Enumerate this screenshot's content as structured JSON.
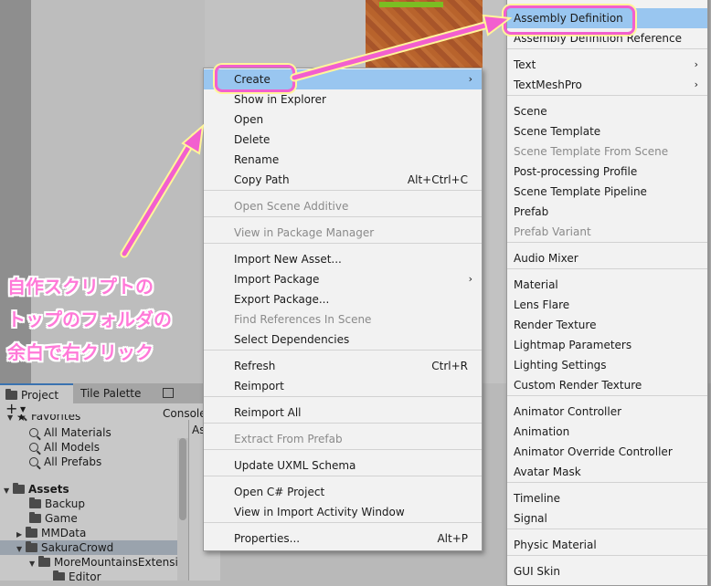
{
  "colors": {
    "accent_pink": "#f25fcf",
    "highlight_blue": "#99c6f0",
    "menu_bg": "#f2f2f2",
    "outline_yellow": "#fff59a"
  },
  "project_window": {
    "tabs": [
      "Project",
      "Tile Palette",
      "Console"
    ],
    "add_button": "+",
    "tree": {
      "favorites_label": "Favorites",
      "favorites": [
        "All Materials",
        "All Models",
        "All Prefabs"
      ],
      "assets_label": "Assets",
      "folders": [
        "Backup",
        "Game",
        "MMData",
        "SakuraCrowd",
        "MoreMountainsExtensi",
        "Editor"
      ]
    },
    "assets_pane_label": "Assets"
  },
  "context_menu": {
    "items": [
      {
        "label": "Create",
        "arrow": "›"
      },
      {
        "label": "Show in Explorer"
      },
      {
        "label": "Open"
      },
      {
        "label": "Delete"
      },
      {
        "label": "Rename"
      },
      {
        "label": "Copy Path",
        "shortcut": "Alt+Ctrl+C"
      },
      {
        "label": "Open Scene Additive"
      },
      {
        "label": "View in Package Manager"
      },
      {
        "label": "Import New Asset..."
      },
      {
        "label": "Import Package",
        "arrow": "›"
      },
      {
        "label": "Export Package..."
      },
      {
        "label": "Find References In Scene"
      },
      {
        "label": "Select Dependencies"
      },
      {
        "label": "Refresh",
        "shortcut": "Ctrl+R"
      },
      {
        "label": "Reimport"
      },
      {
        "label": "Reimport All"
      },
      {
        "label": "Extract From Prefab"
      },
      {
        "label": "Update UXML Schema"
      },
      {
        "label": "Open C# Project"
      },
      {
        "label": "View in Import Activity Window"
      },
      {
        "label": "Properties...",
        "shortcut": "Alt+P"
      }
    ]
  },
  "create_submenu": {
    "items": [
      {
        "label": "Assembly Definition"
      },
      {
        "label": "Assembly Definition Reference"
      },
      {
        "label": "Text",
        "arrow": "›"
      },
      {
        "label": "TextMeshPro",
        "arrow": "›"
      },
      {
        "label": "Scene"
      },
      {
        "label": "Scene Template"
      },
      {
        "label": "Scene Template From Scene"
      },
      {
        "label": "Post-processing Profile"
      },
      {
        "label": "Scene Template Pipeline"
      },
      {
        "label": "Prefab"
      },
      {
        "label": "Prefab Variant"
      },
      {
        "label": "Audio Mixer"
      },
      {
        "label": "Material"
      },
      {
        "label": "Lens Flare"
      },
      {
        "label": "Render Texture"
      },
      {
        "label": "Lightmap Parameters"
      },
      {
        "label": "Lighting Settings"
      },
      {
        "label": "Custom Render Texture"
      },
      {
        "label": "Animator Controller"
      },
      {
        "label": "Animation"
      },
      {
        "label": "Animator Override Controller"
      },
      {
        "label": "Avatar Mask"
      },
      {
        "label": "Timeline"
      },
      {
        "label": "Signal"
      },
      {
        "label": "Physic Material"
      },
      {
        "label": "GUI Skin"
      }
    ]
  },
  "annotation": {
    "lines": [
      "自作スクリプトの",
      "トップのフォルダの",
      "余白で右クリック"
    ]
  }
}
